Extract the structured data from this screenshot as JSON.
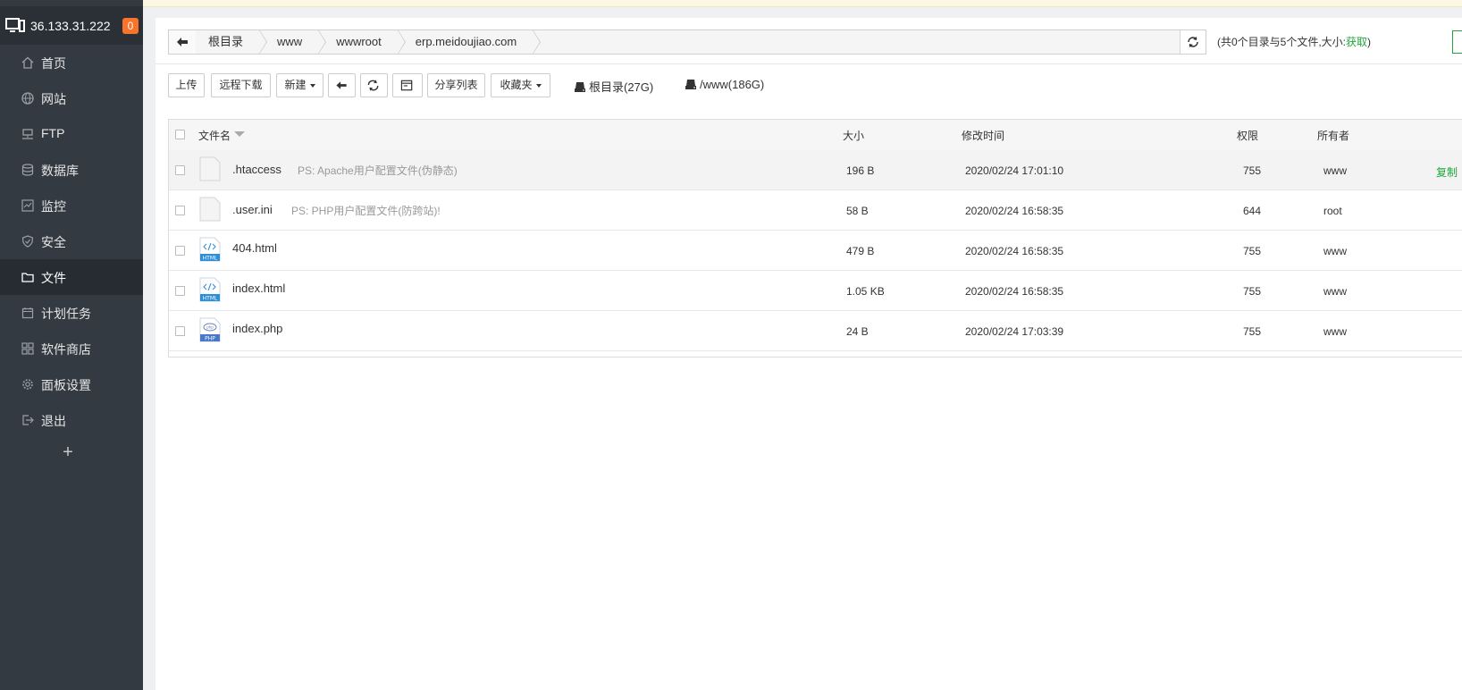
{
  "sidebar": {
    "ip": "36.133.31.222",
    "badge": "0",
    "items": [
      {
        "label": "首页",
        "icon": "home-icon"
      },
      {
        "label": "网站",
        "icon": "globe-icon"
      },
      {
        "label": "FTP",
        "icon": "ftp-icon"
      },
      {
        "label": "数据库",
        "icon": "database-icon"
      },
      {
        "label": "监控",
        "icon": "monitor-icon"
      },
      {
        "label": "安全",
        "icon": "shield-icon"
      },
      {
        "label": "文件",
        "icon": "folder-icon"
      },
      {
        "label": "计划任务",
        "icon": "calendar-icon"
      },
      {
        "label": "软件商店",
        "icon": "grid-icon"
      },
      {
        "label": "面板设置",
        "icon": "gear-icon"
      },
      {
        "label": "退出",
        "icon": "logout-icon"
      }
    ],
    "active_item": "文件",
    "add_label": "+"
  },
  "pathbar": {
    "crumbs": [
      "根目录",
      "www",
      "wwwroot",
      "erp.meidoujiao.com"
    ]
  },
  "summary": {
    "text": "(共0个目录与5个文件,大小:",
    "link": "获取",
    "close": ")"
  },
  "toolbar": {
    "upload": "上传",
    "remote_download": "远程下载",
    "new": "新建",
    "share_list": "分享列表",
    "favorites": "收藏夹",
    "disk_root": "根目录(27G)",
    "disk_www": "/www(186G)"
  },
  "table": {
    "headers": {
      "name": "文件名",
      "size": "大小",
      "mtime": "修改时间",
      "perm": "权限",
      "owner": "所有者"
    },
    "rows": [
      {
        "name": ".htaccess",
        "note": "PS: Apache用户配置文件(伪静态)",
        "size": "196 B",
        "mtime": "2020/02/24 17:01:10",
        "perm": "755",
        "owner": "www",
        "type": "blank",
        "action": "复制"
      },
      {
        "name": ".user.ini",
        "note": "PS: PHP用户配置文件(防跨站)!",
        "size": "58 B",
        "mtime": "2020/02/24 16:58:35",
        "perm": "644",
        "owner": "root",
        "type": "blank"
      },
      {
        "name": "404.html",
        "note": "",
        "size": "479 B",
        "mtime": "2020/02/24 16:58:35",
        "perm": "755",
        "owner": "www",
        "type": "html"
      },
      {
        "name": "index.html",
        "note": "",
        "size": "1.05 KB",
        "mtime": "2020/02/24 16:58:35",
        "perm": "755",
        "owner": "www",
        "type": "html"
      },
      {
        "name": "index.php",
        "note": "",
        "size": "24 B",
        "mtime": "2020/02/24 17:03:39",
        "perm": "755",
        "owner": "www",
        "type": "php"
      }
    ]
  },
  "colors": {
    "accent": "#20a53a",
    "sidebar": "#333a41",
    "badge": "#f7742a"
  }
}
